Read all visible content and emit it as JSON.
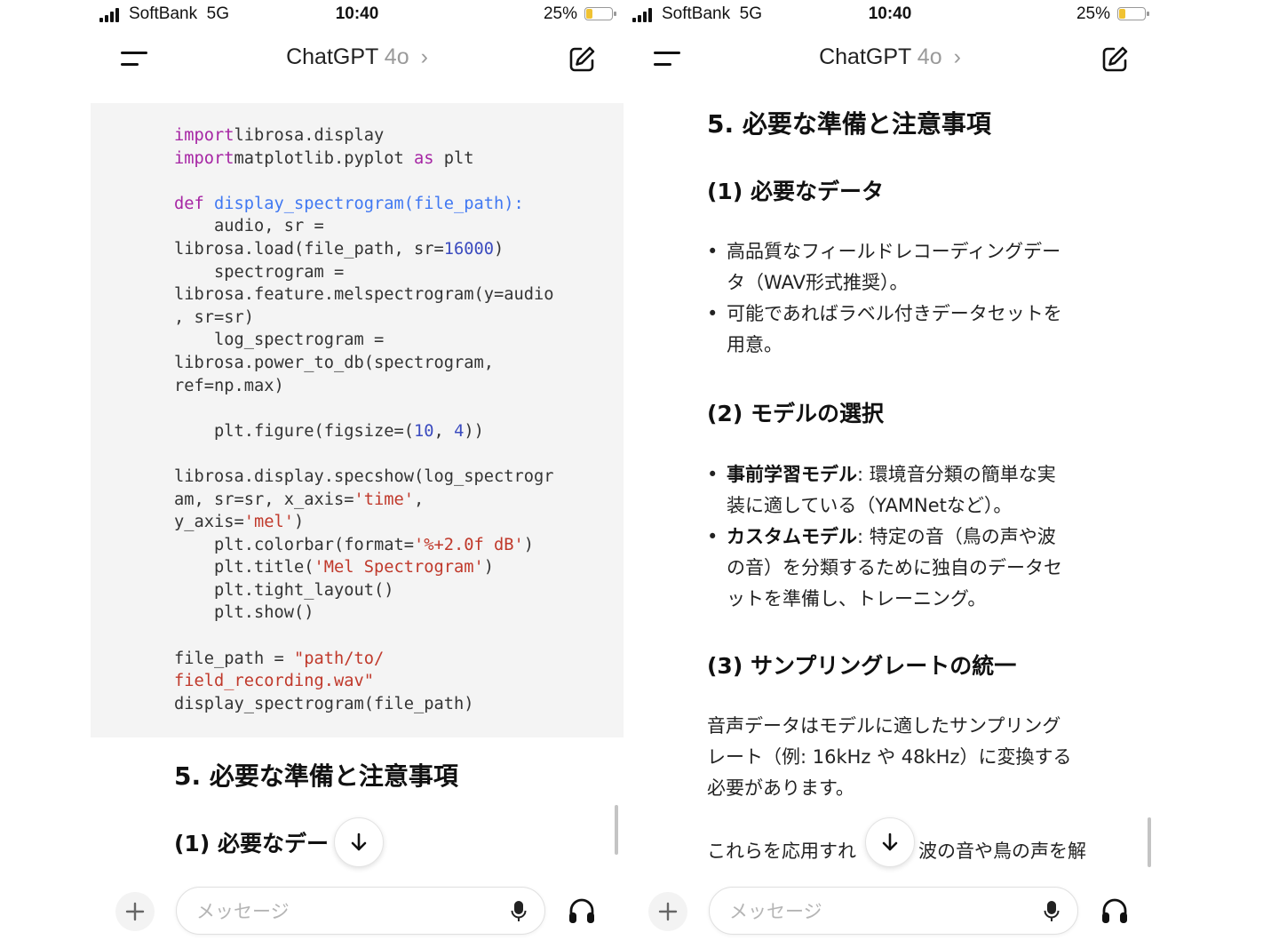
{
  "status": {
    "carrier": "SoftBank",
    "network": "5G",
    "time": "10:40",
    "battery": "25%",
    "battery_level": 0.25,
    "battery_color": "#f0c232"
  },
  "header": {
    "model": "ChatGPT",
    "version": "4o",
    "chevron": "›"
  },
  "code_lines": [
    [
      [
        "kw",
        "import"
      ],
      [
        "",
        "librosa.display"
      ]
    ],
    [
      [
        "kw",
        "import"
      ],
      [
        "",
        "matplotlib.pyplot "
      ],
      [
        "kw",
        "as"
      ],
      [
        "",
        " plt"
      ]
    ],
    [],
    [
      [
        "kw",
        "def"
      ],
      [
        "",
        " "
      ],
      [
        "fn",
        "display_spectrogram(file_path):"
      ]
    ],
    [
      [
        "",
        "    audio, sr ="
      ]
    ],
    [
      [
        "",
        "librosa.load(file_path, sr="
      ],
      [
        "num",
        "16000"
      ],
      [
        "",
        ")"
      ]
    ],
    [
      [
        "",
        "    spectrogram ="
      ]
    ],
    [
      [
        "",
        "librosa.feature.melspectrogram(y=audio"
      ]
    ],
    [
      [
        "",
        ", sr=sr)"
      ]
    ],
    [
      [
        "",
        "    log_spectrogram ="
      ]
    ],
    [
      [
        "",
        "librosa.power_to_db(spectrogram,"
      ]
    ],
    [
      [
        "",
        "ref=np.max)"
      ]
    ],
    [],
    [
      [
        "",
        "    plt.figure(figsize=("
      ],
      [
        "num",
        "10"
      ],
      [
        "",
        ", "
      ],
      [
        "num",
        "4"
      ],
      [
        "",
        "))"
      ]
    ],
    [],
    [
      [
        "",
        "librosa.display.specshow(log_spectrogr"
      ]
    ],
    [
      [
        "",
        "am, sr=sr, x_axis="
      ],
      [
        "str",
        "'time'"
      ],
      [
        "",
        ","
      ]
    ],
    [
      [
        "",
        "y_axis="
      ],
      [
        "str",
        "'mel'"
      ],
      [
        "",
        ")"
      ]
    ],
    [
      [
        "",
        "    plt.colorbar(format="
      ],
      [
        "str",
        "'%+2.0f dB'"
      ],
      [
        "",
        ")"
      ]
    ],
    [
      [
        "",
        "    plt.title("
      ],
      [
        "str",
        "'Mel Spectrogram'"
      ],
      [
        "",
        ")"
      ]
    ],
    [
      [
        "",
        "    plt.tight_layout()"
      ]
    ],
    [
      [
        "",
        "    plt.show()"
      ]
    ],
    [],
    [
      [
        "",
        "file_path = "
      ],
      [
        "str",
        "\"path/to/"
      ]
    ],
    [
      [
        "str",
        "field_recording.wav\""
      ]
    ],
    [
      [
        "",
        "display_spectrogram(file_path)"
      ]
    ]
  ],
  "left": {
    "section_title": "5. 必要な準備と注意事項",
    "subtitle_partial": "(1) 必要なデー"
  },
  "right": {
    "section_title": "5. 必要な準備と注意事項",
    "sub1": {
      "title": "(1) 必要なデータ",
      "items": [
        {
          "line1": "高品質なフィールドレコーディングデー",
          "line2": "タ（WAV形式推奨）。"
        },
        {
          "line1": "可能であればラベル付きデータセットを",
          "line2": "用意。"
        }
      ]
    },
    "sub2": {
      "title": "(2) モデルの選択",
      "items": [
        {
          "bold": "事前学習モデル",
          "line1": ": 環境音分類の簡単な実",
          "line2": "装に適している（YAMNetなど）。"
        },
        {
          "bold": "カスタムモデル",
          "line1": ": 特定の音（鳥の声や波",
          "line2": "の音）を分類するために独自のデータセ",
          "line3": "ットを準備し、トレーニング。"
        }
      ]
    },
    "sub3": {
      "title": "(3) サンプリングレートの統一",
      "line1": "音声データはモデルに適したサンプリング",
      "line2": "レート（例: 16kHz や 48kHz）に変換する",
      "line3": "必要があります。"
    },
    "partial_a": "これらを応用すれ",
    "partial_b": "波の音や鳥の声を解"
  },
  "composer": {
    "placeholder": "メッセージ"
  }
}
